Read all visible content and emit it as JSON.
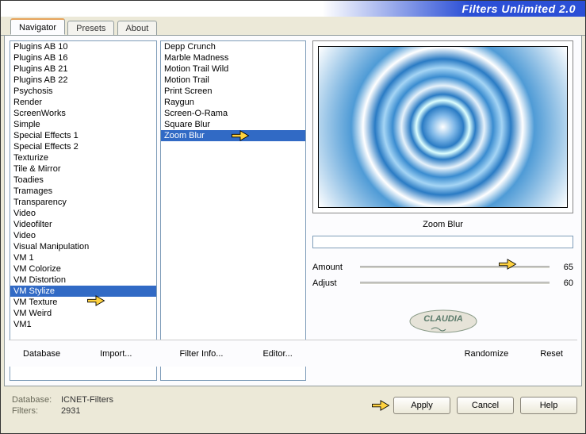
{
  "app": {
    "title": "Filters Unlimited 2.0"
  },
  "tabs": {
    "navigator": "Navigator",
    "presets": "Presets",
    "about": "About"
  },
  "categories": [
    "Plugins AB 10",
    "Plugins AB 16",
    "Plugins AB 21",
    "Plugins AB 22",
    "Psychosis",
    "Render",
    "ScreenWorks",
    "Simple",
    "Special Effects 1",
    "Special Effects 2",
    "Texturize",
    "Tile & Mirror",
    "Toadies",
    "Tramages",
    "Transparency",
    "Video",
    "Videofilter",
    "Video",
    "Visual Manipulation",
    "VM 1",
    "VM Colorize",
    "VM Distortion",
    "VM Stylize",
    "VM Texture",
    "VM Weird",
    "VM1"
  ],
  "selected_category": "VM Stylize",
  "filters": [
    "Depp Crunch",
    "Marble Madness",
    "Motion Trail Wild",
    "Motion Trail",
    "Print Screen",
    "Raygun",
    "Screen-O-Rama",
    "Square Blur",
    "Zoom Blur"
  ],
  "selected_filter": "Zoom Blur",
  "preview": {
    "title": "Zoom Blur"
  },
  "params": {
    "amount": {
      "label": "Amount",
      "value": "65"
    },
    "adjust": {
      "label": "Adjust",
      "value": "60"
    }
  },
  "logo": "CLAUDIA",
  "toolbar": {
    "database": "Database",
    "import": "Import...",
    "filterinfo": "Filter Info...",
    "editor": "Editor...",
    "randomize": "Randomize",
    "reset": "Reset"
  },
  "status": {
    "db_label": "Database:",
    "db_value": "ICNET-Filters",
    "count_label": "Filters:",
    "count_value": "2931"
  },
  "buttons": {
    "apply": "Apply",
    "cancel": "Cancel",
    "help": "Help"
  }
}
